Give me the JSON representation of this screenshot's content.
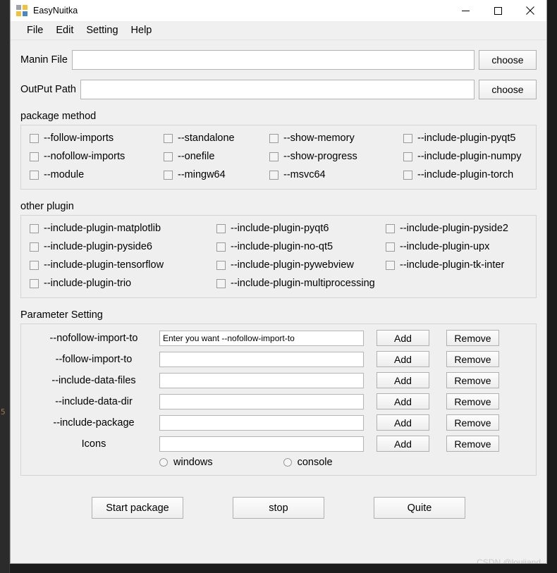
{
  "window": {
    "title": "EasyNuitka",
    "icon": "app-grid-icon",
    "controls": {
      "minimize": "minimize-icon",
      "maximize": "maximize-icon",
      "close": "close-icon"
    }
  },
  "menubar": {
    "items": [
      {
        "label": "File"
      },
      {
        "label": "Edit"
      },
      {
        "label": "Setting"
      },
      {
        "label": "Help"
      }
    ]
  },
  "paths": {
    "rows": [
      {
        "label": "Manin File",
        "value": "",
        "placeholder": "",
        "button": "choose"
      },
      {
        "label": "OutPut Path",
        "value": "",
        "placeholder": "",
        "button": "choose"
      }
    ]
  },
  "package_method": {
    "title": "package method",
    "options": [
      {
        "label": "--follow-imports",
        "checked": false
      },
      {
        "label": "--standalone",
        "checked": false
      },
      {
        "label": "--show-memory",
        "checked": false
      },
      {
        "label": "--include-plugin-pyqt5",
        "checked": false
      },
      {
        "label": "--nofollow-imports",
        "checked": false
      },
      {
        "label": "--onefile",
        "checked": false
      },
      {
        "label": "--show-progress",
        "checked": false
      },
      {
        "label": "--include-plugin-numpy",
        "checked": false
      },
      {
        "label": "--module",
        "checked": false
      },
      {
        "label": "--mingw64",
        "checked": false
      },
      {
        "label": "--msvc64",
        "checked": false
      },
      {
        "label": "--include-plugin-torch",
        "checked": false
      }
    ]
  },
  "other_plugin": {
    "title": "other plugin",
    "options": [
      {
        "label": "--include-plugin-matplotlib",
        "checked": false
      },
      {
        "label": "--include-plugin-pyqt6",
        "checked": false
      },
      {
        "label": "--include-plugin-pyside2",
        "checked": false
      },
      {
        "label": "--include-plugin-pyside6",
        "checked": false
      },
      {
        "label": "--include-plugin-no-qt5",
        "checked": false
      },
      {
        "label": "--include-plugin-upx",
        "checked": false
      },
      {
        "label": "--include-plugin-tensorflow",
        "checked": false
      },
      {
        "label": "--include-plugin-pywebview",
        "checked": false
      },
      {
        "label": "--include-plugin-tk-inter",
        "checked": false
      },
      {
        "label": "--include-plugin-trio",
        "checked": false
      },
      {
        "label": "--include-plugin-multiprocessing",
        "checked": false
      },
      {
        "label": "",
        "checked": false
      }
    ]
  },
  "parameter_setting": {
    "title": "Parameter Setting",
    "add_label": "Add",
    "remove_label": "Remove",
    "rows": [
      {
        "label": "--nofollow-import-to",
        "value": "",
        "placeholder": "Enter you want --nofollow-import-to"
      },
      {
        "label": "--follow-import-to",
        "value": "",
        "placeholder": ""
      },
      {
        "label": "--include-data-files",
        "value": "",
        "placeholder": ""
      },
      {
        "label": "--include-data-dir",
        "value": "",
        "placeholder": ""
      },
      {
        "label": "--include-package",
        "value": "",
        "placeholder": ""
      },
      {
        "label": "Icons",
        "value": "",
        "placeholder": ""
      }
    ],
    "radios": [
      {
        "label": "windows",
        "selected": false
      },
      {
        "label": "console",
        "selected": false
      }
    ]
  },
  "actions": {
    "start": "Start package",
    "stop": "stop",
    "quit": "Quite"
  },
  "watermark": "CSDN @loujiand",
  "backdrop": {
    "line_number": "5"
  }
}
